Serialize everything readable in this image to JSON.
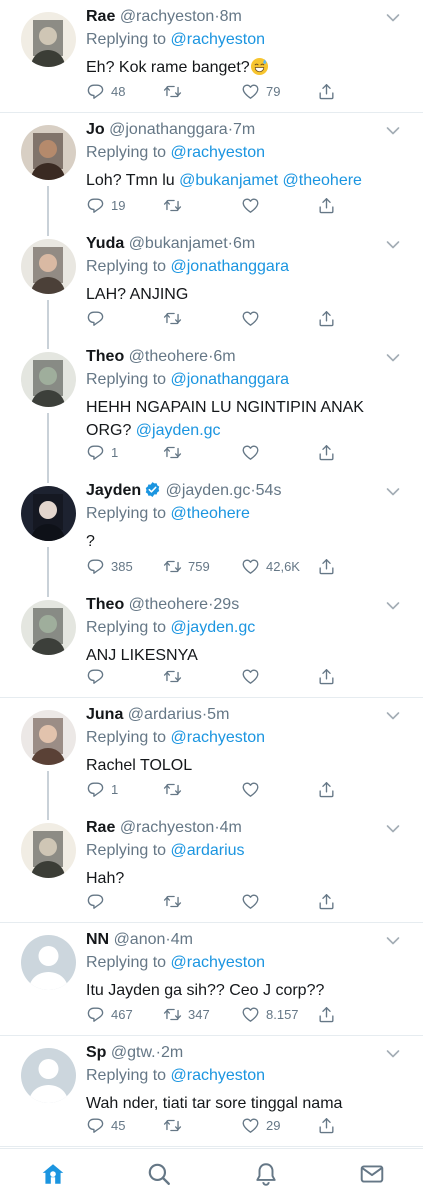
{
  "app": {
    "name": "Twitter",
    "accent": "#1b95e0",
    "muted": "#657786",
    "text": "#14171a"
  },
  "tweets": [
    {
      "name": "Rae",
      "handle": "@rachyeston",
      "dot": "·",
      "time": "8m",
      "verified": false,
      "replying_prefix": "Replying to ",
      "replying_to": "@rachyeston",
      "text": "Eh? Kok rame banget?",
      "emoji": "grinning-sweat-emoji",
      "mentions": [],
      "counts": {
        "reply": "48",
        "retweet": "",
        "like": "79"
      },
      "avatar": "photo",
      "thread_line_after": false
    },
    {
      "name": "Jo",
      "handle": "@jonathanggara",
      "dot": "·",
      "time": "7m",
      "verified": false,
      "replying_prefix": "Replying to ",
      "replying_to": "@rachyeston",
      "text": "Loh? Tmn lu",
      "mentions": [
        "@bukanjamet",
        "@theohere"
      ],
      "counts": {
        "reply": "19",
        "retweet": "",
        "like": ""
      },
      "avatar": "photo",
      "thread_line_after": true
    },
    {
      "name": "Yuda",
      "handle": "@bukanjamet",
      "dot": "·",
      "time": "6m",
      "verified": false,
      "replying_prefix": "Replying to ",
      "replying_to": "@jonathanggara",
      "text": "LAH? ANJING",
      "mentions": [],
      "counts": {
        "reply": "",
        "retweet": "",
        "like": ""
      },
      "avatar": "photo",
      "thread_line_after": true
    },
    {
      "name": "Theo",
      "handle": "@theohere",
      "dot": "·",
      "time": "6m",
      "verified": false,
      "replying_prefix": "Replying to ",
      "replying_to": "@jonathanggara",
      "text": "HEHH NGAPAIN LU NGINTIPIN ANAK ORG?",
      "mentions": [
        "@jayden.gc"
      ],
      "counts": {
        "reply": "1",
        "retweet": "",
        "like": ""
      },
      "avatar": "photo",
      "thread_line_after": true
    },
    {
      "name": "Jayden",
      "handle": "@jayden.gc",
      "dot": "·",
      "time": "54s",
      "verified": true,
      "replying_prefix": "Replying to ",
      "replying_to": "@theohere",
      "text": "?",
      "mentions": [],
      "counts": {
        "reply": "385",
        "retweet": "759",
        "like": "42,6K"
      },
      "avatar": "photo",
      "thread_line_after": true
    },
    {
      "name": "Theo",
      "handle": "@theohere",
      "dot": "·",
      "time": "29s",
      "verified": false,
      "replying_prefix": "Replying to ",
      "replying_to": "@jayden.gc",
      "text": "ANJ LIKESNYA",
      "mentions": [],
      "counts": {
        "reply": "",
        "retweet": "",
        "like": ""
      },
      "avatar": "photo",
      "thread_line_after": false
    },
    {
      "name": "Juna",
      "handle": "@ardarius",
      "dot": "·",
      "time": "5m",
      "verified": false,
      "replying_prefix": "Replying to ",
      "replying_to": "@rachyeston",
      "text": "Rachel TOLOL",
      "mentions": [],
      "counts": {
        "reply": "1",
        "retweet": "",
        "like": ""
      },
      "avatar": "photo",
      "thread_line_after": true
    },
    {
      "name": "Rae",
      "handle": "@rachyeston",
      "dot": "·",
      "time": "4m",
      "verified": false,
      "replying_prefix": "Replying to ",
      "replying_to": "@ardarius",
      "text": "Hah?",
      "mentions": [],
      "counts": {
        "reply": "",
        "retweet": "",
        "like": ""
      },
      "avatar": "photo",
      "thread_line_after": false
    },
    {
      "name": "NN",
      "handle": "@anon",
      "dot": "·",
      "time": "4m",
      "verified": false,
      "replying_prefix": "Replying to ",
      "replying_to": "@rachyeston",
      "text": "Itu Jayden ga sih?? Ceo J corp??",
      "mentions": [],
      "counts": {
        "reply": "467",
        "retweet": "347",
        "like": "8.157"
      },
      "avatar": "default",
      "thread_line_after": false
    },
    {
      "name": "Sp",
      "handle": "@gtw.",
      "dot": "·",
      "time": "2m",
      "verified": false,
      "replying_prefix": "Replying to ",
      "replying_to": "@rachyeston",
      "text": "Wah nder, tiati tar sore tinggal nama",
      "mentions": [],
      "counts": {
        "reply": "45",
        "retweet": "",
        "like": "29"
      },
      "avatar": "default",
      "thread_line_after": false
    }
  ],
  "icons": {
    "reply": "reply-icon",
    "retweet": "retweet-icon",
    "like": "heart-icon",
    "share": "share-icon",
    "menu": "chevron-down-icon",
    "verified": "verified-badge-icon"
  },
  "tabbar": [
    {
      "name": "home",
      "icon": "home-icon",
      "active": true
    },
    {
      "name": "search",
      "icon": "search-icon",
      "active": false
    },
    {
      "name": "notifications",
      "icon": "bell-icon",
      "active": false
    },
    {
      "name": "messages",
      "icon": "mail-icon",
      "active": false
    }
  ]
}
